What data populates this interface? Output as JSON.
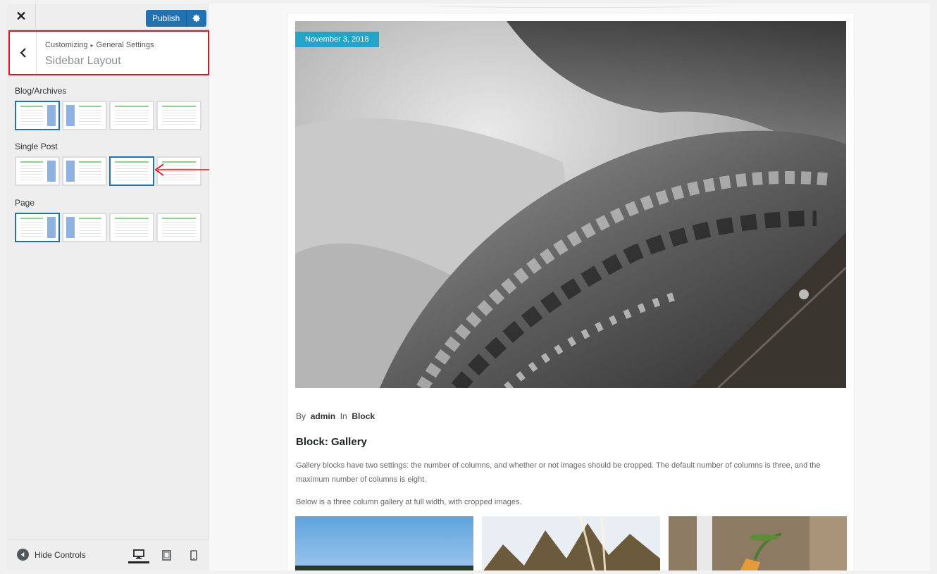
{
  "sidebar": {
    "close_label": "✕",
    "publish_label": "Publish",
    "breadcrumb": {
      "root": "Customizing",
      "separator": "▸",
      "parent": "General Settings"
    },
    "section_title": "Sidebar Layout",
    "groups": [
      {
        "label": "Blog/Archives",
        "selected_index": 0
      },
      {
        "label": "Single Post",
        "selected_index": 2
      },
      {
        "label": "Page",
        "selected_index": 0
      }
    ],
    "layout_options": [
      "right-sidebar",
      "left-sidebar",
      "full-width",
      "no-sidebar"
    ],
    "hide_controls_label": "Hide Controls",
    "devices": [
      "desktop",
      "tablet",
      "mobile"
    ],
    "active_device": "desktop"
  },
  "preview": {
    "date": "November 3, 2018",
    "meta": {
      "by": "By",
      "author": "admin",
      "in": "In",
      "category": "Block"
    },
    "post_title": "Block: Gallery",
    "paragraph_1": "Gallery blocks have two settings: the number of columns, and whether or not images should be cropped. The default number of columns is three, and the maximum number of columns is eight.",
    "paragraph_2": "Below is a three column gallery at full width, with cropped images."
  },
  "colors": {
    "accent": "#2271b1",
    "highlight_box": "#e0121b",
    "date_badge": "#25a4c9"
  }
}
